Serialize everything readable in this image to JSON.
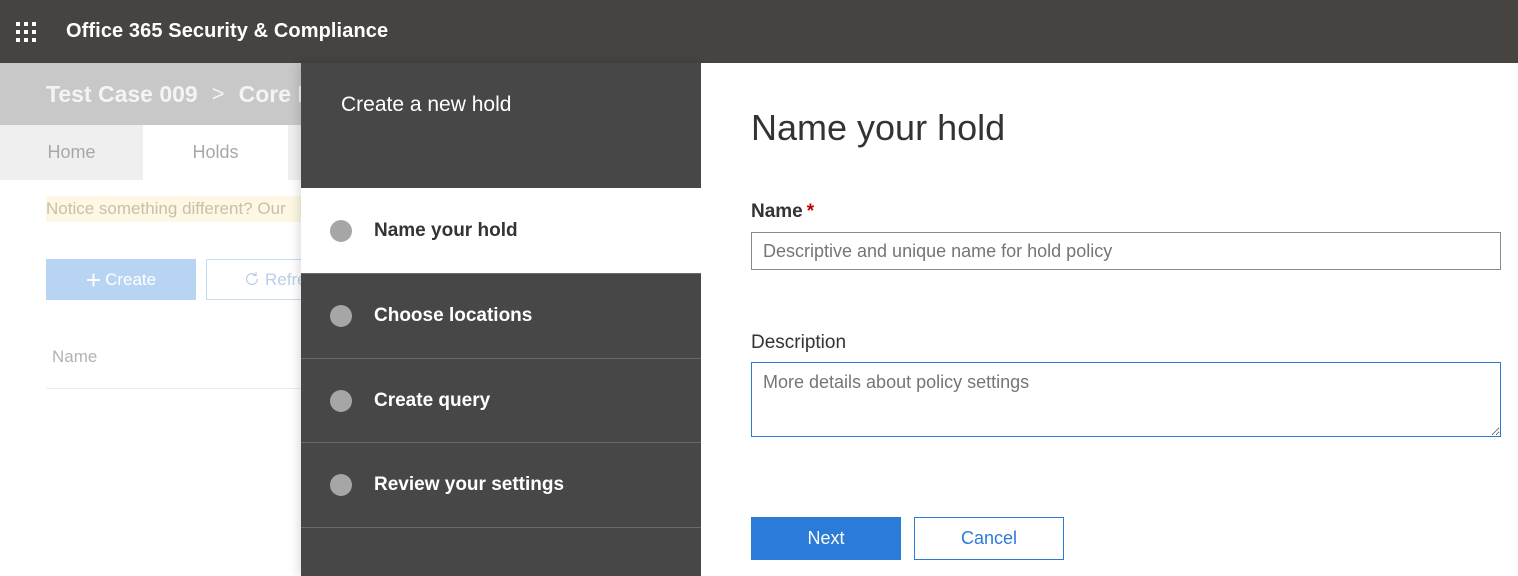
{
  "topbar": {
    "app_title": "Office 365 Security & Compliance",
    "waffle_icon": "app-launcher-icon"
  },
  "background": {
    "breadcrumb": [
      "Test Case 009",
      "Core ED"
    ],
    "breadcrumb_separator": ">",
    "tabs": [
      {
        "label": "Home"
      },
      {
        "label": "Holds"
      }
    ],
    "notice": "Notice something different? Our",
    "create_button": "Create",
    "refresh_button": "Refre",
    "column_header": "Name"
  },
  "wizard": {
    "title": "Create a new hold",
    "steps": [
      {
        "label": "Name your hold",
        "active": true
      },
      {
        "label": "Choose locations",
        "active": false
      },
      {
        "label": "Create query",
        "active": false
      },
      {
        "label": "Review your settings",
        "active": false
      }
    ]
  },
  "form": {
    "heading": "Name your hold",
    "name_label": "Name",
    "required_marker": "*",
    "name_placeholder": "Descriptive and unique name for hold policy",
    "description_label": "Description",
    "description_placeholder": "More details about policy settings",
    "next_button": "Next",
    "cancel_button": "Cancel"
  },
  "colors": {
    "topbar": "#464340",
    "wizard_nav": "#474747",
    "primary": "#2b7bd8",
    "required": "#c00000"
  }
}
